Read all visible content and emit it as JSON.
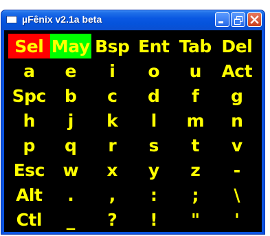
{
  "window": {
    "title": "µFênix v2.1a beta",
    "colors": {
      "background": "#000000",
      "key_text": "#ffff00",
      "sel_highlight": "#ff0000",
      "may_highlight": "#00ff00",
      "titlebar": "#0a58e2"
    }
  },
  "keyboard": {
    "rows": [
      [
        "Sel",
        "May",
        "Bsp",
        "Ent",
        "Tab",
        "Del"
      ],
      [
        "a",
        "e",
        "i",
        "o",
        "u",
        "Act"
      ],
      [
        "Spc",
        "b",
        "c",
        "d",
        "f",
        "g"
      ],
      [
        "h",
        "j",
        "k",
        "l",
        "m",
        "n"
      ],
      [
        "p",
        "q",
        "r",
        "s",
        "t",
        "v"
      ],
      [
        "Esc",
        "w",
        "x",
        "y",
        "z",
        "-"
      ],
      [
        "Alt",
        ".",
        ",",
        ":",
        ";",
        "\\"
      ],
      [
        "Ctl",
        "_",
        "?",
        "!",
        "\"",
        "'"
      ]
    ]
  }
}
